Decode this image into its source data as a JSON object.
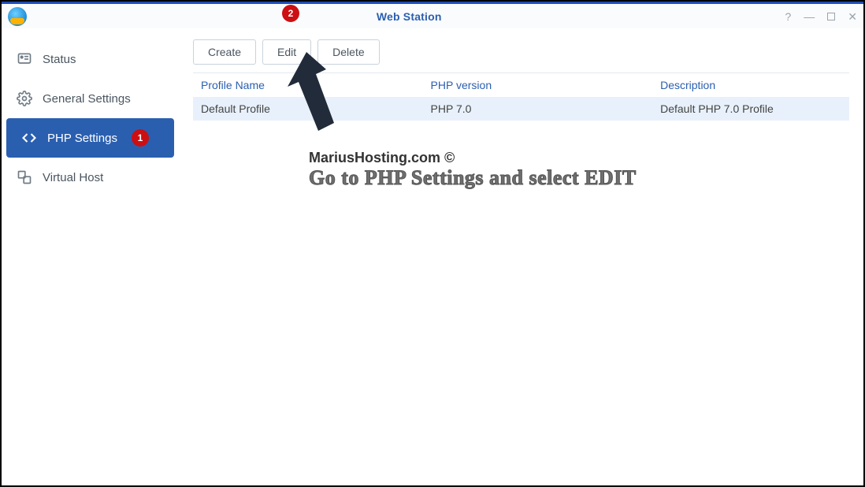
{
  "window": {
    "title": "Web Station"
  },
  "sidebar": {
    "items": [
      {
        "label": "Status"
      },
      {
        "label": "General Settings"
      },
      {
        "label": "PHP Settings",
        "badge": "1"
      },
      {
        "label": "Virtual Host"
      }
    ]
  },
  "toolbar": {
    "create": "Create",
    "edit": "Edit",
    "delete": "Delete"
  },
  "table": {
    "headers": {
      "name": "Profile Name",
      "version": "PHP version",
      "description": "Description"
    },
    "rows": [
      {
        "name": "Default Profile",
        "version": "PHP 7.0",
        "description": "Default PHP 7.0 Profile"
      }
    ]
  },
  "annotations": {
    "badge2": "2",
    "watermark_line1": "MariusHosting.com ©",
    "watermark_line2": "Go to PHP Settings and select EDIT"
  }
}
